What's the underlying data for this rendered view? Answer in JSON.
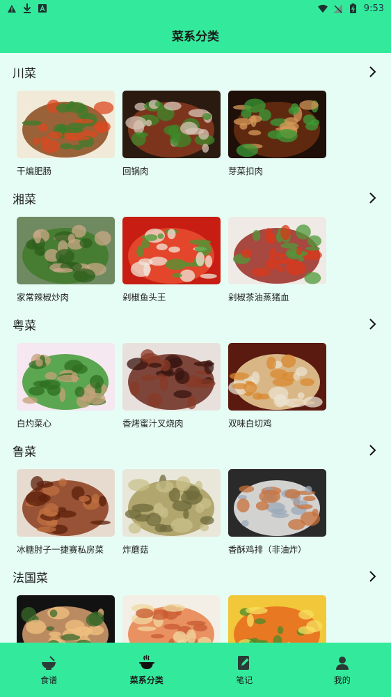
{
  "status_bar": {
    "time": "9:53"
  },
  "app_bar": {
    "title": "菜系分类"
  },
  "sections": [
    {
      "title": "川菜",
      "dishes": [
        {
          "name": "干煸肥肠",
          "colors": [
            "#f2ead9",
            "#8a4a1c",
            "#3b7d2a",
            "#d94a20"
          ]
        },
        {
          "name": "回锅肉",
          "colors": [
            "#2b1a10",
            "#8b3b1e",
            "#3e8a2a",
            "#d8c4b5"
          ]
        },
        {
          "name": "芽菜扣肉",
          "colors": [
            "#1e0f08",
            "#6b2e12",
            "#d69a5a",
            "#3a9c35"
          ]
        }
      ]
    },
    {
      "title": "湘菜",
      "dishes": [
        {
          "name": "家常辣椒炒肉",
          "colors": [
            "#6f8a60",
            "#3f7a2a",
            "#c9a787",
            "#2f5f1e"
          ]
        },
        {
          "name": "剁椒鱼头王",
          "colors": [
            "#c71d12",
            "#e84d30",
            "#f0e6d9",
            "#4b9a35"
          ]
        },
        {
          "name": "剁椒茶油蒸猪血",
          "colors": [
            "#efeae5",
            "#9a2c24",
            "#d9381a",
            "#4f9a3a"
          ]
        }
      ]
    },
    {
      "title": "粤菜",
      "dishes": [
        {
          "name": "白灼菜心",
          "colors": [
            "#f5e8f0",
            "#3f9a35",
            "#2d6e20",
            "#c6a27a"
          ]
        },
        {
          "name": "香烤蜜汁叉烧肉",
          "colors": [
            "#e8e0dc",
            "#6b2a1e",
            "#8a3a25",
            "#3a1510"
          ]
        },
        {
          "name": "双味白切鸡",
          "colors": [
            "#5a1a10",
            "#f0d29a",
            "#d88a30",
            "#e9e2cf"
          ]
        }
      ]
    },
    {
      "title": "鲁菜",
      "dishes": [
        {
          "name": "冰糖肘子一捷赛私房菜",
          "colors": [
            "#e7dbd0",
            "#8a3a1a",
            "#5c200c",
            "#c07040"
          ]
        },
        {
          "name": "炸蘑菇",
          "colors": [
            "#e9e6da",
            "#a89a5c",
            "#6d6a3a",
            "#c8c08a"
          ]
        },
        {
          "name": "香酥鸡排（非油炸）",
          "colors": [
            "#2b2a2a",
            "#f0f0ee",
            "#c8703a",
            "#9aa8b8"
          ]
        }
      ]
    },
    {
      "title": "法国菜",
      "dishes": [
        {
          "name": "",
          "colors": [
            "#121212",
            "#d8a070",
            "#f0c080",
            "#3a6a2a"
          ]
        },
        {
          "name": "",
          "colors": [
            "#f3efe6",
            "#e8804a",
            "#c85a30",
            "#f0d8a0"
          ]
        },
        {
          "name": "",
          "colors": [
            "#f2c83a",
            "#e86a20",
            "#f5e060",
            "#4a8a2a"
          ]
        }
      ]
    }
  ],
  "bottom_nav": {
    "items": [
      {
        "label": "食谱",
        "icon": "bowl-icon",
        "active": false
      },
      {
        "label": "菜系分类",
        "icon": "cooking-pot-icon",
        "active": true
      },
      {
        "label": "笔记",
        "icon": "note-edit-icon",
        "active": false
      },
      {
        "label": "我的",
        "icon": "user-icon",
        "active": false
      }
    ]
  },
  "colors": {
    "accent": "#33ea9c",
    "background": "#e6fdf5"
  }
}
